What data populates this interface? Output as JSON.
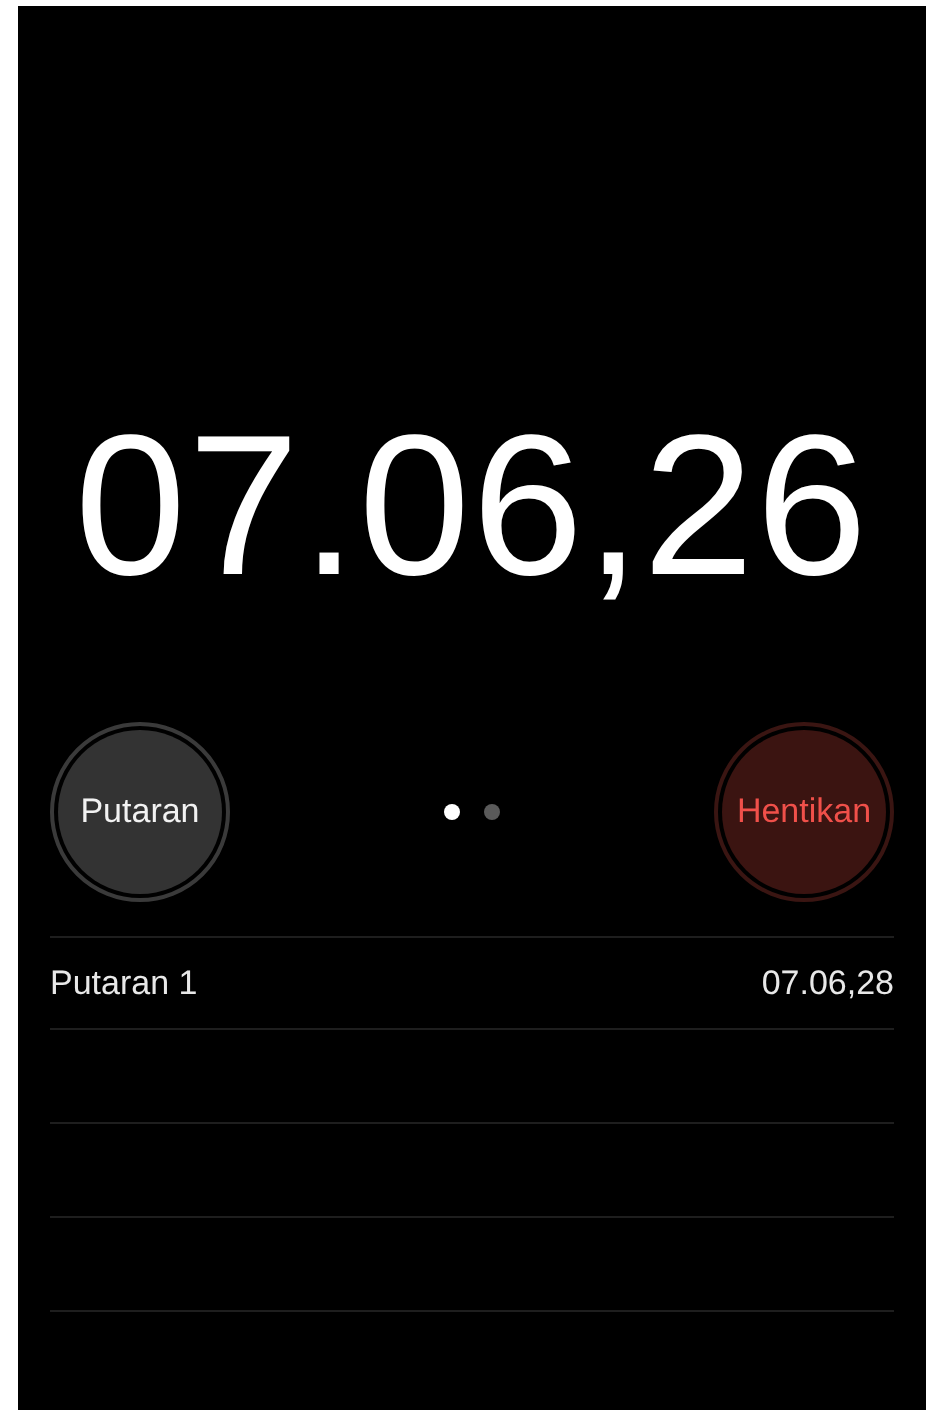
{
  "timer": {
    "display": "07.06,26"
  },
  "buttons": [
    {
      "kind": "lap",
      "label": "Putaran"
    },
    {
      "kind": "stop",
      "label": "Hentikan"
    }
  ],
  "page_dots": [
    {
      "selected": true
    },
    {
      "selected": false
    }
  ],
  "laps": [
    {
      "name": "Putaran 1",
      "time": "07.06,28"
    }
  ]
}
